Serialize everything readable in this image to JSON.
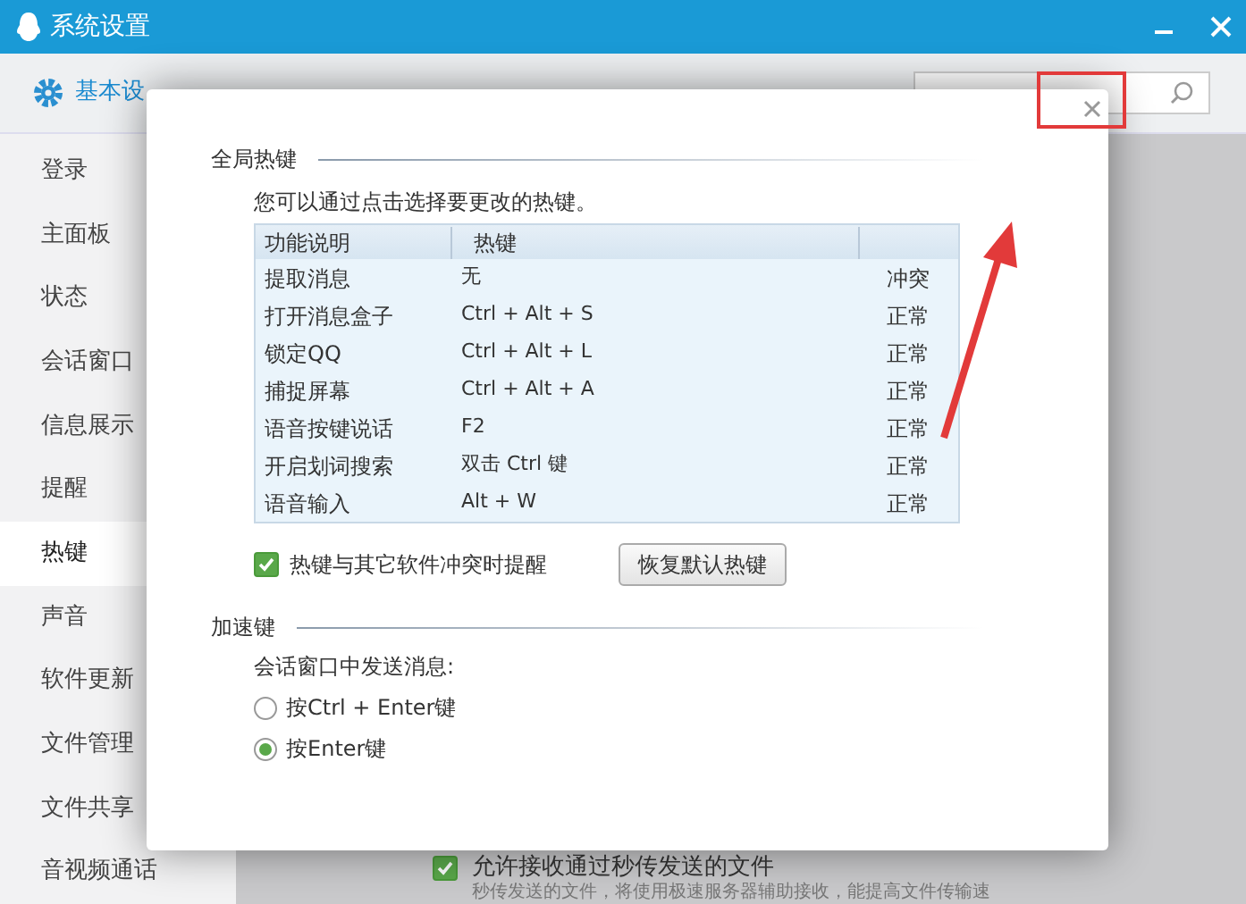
{
  "window": {
    "title": "系统设置"
  },
  "tabs": [
    {
      "label": "基本设",
      "selected": true
    }
  ],
  "sidebar": {
    "items": [
      {
        "label": "登录",
        "selected": false
      },
      {
        "label": "主面板",
        "selected": false
      },
      {
        "label": "状态",
        "selected": false
      },
      {
        "label": "会话窗口",
        "selected": false
      },
      {
        "label": "信息展示",
        "selected": false
      },
      {
        "label": "提醒",
        "selected": false
      },
      {
        "label": "热键",
        "selected": true
      },
      {
        "label": "声音",
        "selected": false
      },
      {
        "label": "软件更新",
        "selected": false
      },
      {
        "label": "文件管理",
        "selected": false
      },
      {
        "label": "文件共享",
        "selected": false
      },
      {
        "label": "音视频通话",
        "selected": false
      }
    ]
  },
  "background_option": {
    "label": "允许接收通过秒传发送的文件",
    "checked": true,
    "description": "秒传发送的文件，将使用极速服务器辅助接收，能提高文件传输速"
  },
  "dialog": {
    "global_hotkeys": {
      "title": "全局热键",
      "hint": "您可以通过点击选择要更改的热键。",
      "columns": [
        "功能说明",
        "热键"
      ],
      "rows": [
        {
          "function": "提取消息",
          "hotkey": "无",
          "status": "冲突"
        },
        {
          "function": "打开消息盒子",
          "hotkey": "Ctrl + Alt + S",
          "status": "正常"
        },
        {
          "function": "锁定QQ",
          "hotkey": "Ctrl + Alt + L",
          "status": "正常"
        },
        {
          "function": "捕捉屏幕",
          "hotkey": "Ctrl + Alt + A",
          "status": "正常"
        },
        {
          "function": "语音按键说话",
          "hotkey": "F2",
          "status": "正常"
        },
        {
          "function": "开启划词搜索",
          "hotkey": "双击 Ctrl 键",
          "status": "正常"
        },
        {
          "function": "语音输入",
          "hotkey": "Alt + W",
          "status": "正常"
        }
      ],
      "conflict_alert": {
        "label": "热键与其它软件冲突时提醒",
        "checked": true
      },
      "restore_button": "恢复默认热键"
    },
    "accelerator": {
      "title": "加速键",
      "prompt": "会话窗口中发送消息:",
      "options": [
        {
          "label": "按Ctrl + Enter键",
          "selected": false
        },
        {
          "label": "按Enter键",
          "selected": true
        }
      ]
    }
  }
}
